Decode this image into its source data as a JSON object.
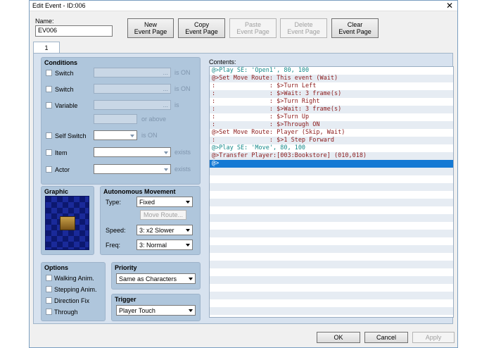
{
  "window": {
    "title": "Edit Event - ID:006",
    "close": "✕"
  },
  "name": {
    "label": "Name:",
    "value": "EV006"
  },
  "toolbar": {
    "new": "New\nEvent Page",
    "copy": "Copy\nEvent Page",
    "paste": "Paste\nEvent Page",
    "delete": "Delete\nEvent Page",
    "clear": "Clear\nEvent Page"
  },
  "tab": "1",
  "conditions": {
    "title": "Conditions",
    "switch1": "Switch",
    "switch2": "Switch",
    "variable": "Variable",
    "self_switch": "Self Switch",
    "item": "Item",
    "actor": "Actor",
    "is_on": "is ON",
    "is": "is",
    "or_above": "or above",
    "exists": "exists",
    "ellipsis": "..."
  },
  "graphic": {
    "title": "Graphic"
  },
  "movement": {
    "title": "Autonomous Movement",
    "type_label": "Type:",
    "type": "Fixed",
    "route": "Move Route...",
    "speed_label": "Speed:",
    "speed": "3: x2 Slower",
    "freq_label": "Freq:",
    "freq": "3: Normal"
  },
  "options": {
    "title": "Options",
    "walking": "Walking Anim.",
    "stepping": "Stepping Anim.",
    "direction": "Direction Fix",
    "through": "Through"
  },
  "priority": {
    "title": "Priority",
    "value": "Same as Characters"
  },
  "trigger": {
    "title": "Trigger",
    "value": "Player Touch"
  },
  "contents": {
    "title": "Contents:",
    "lines": [
      {
        "text": "@>Play SE: 'Open1', 80, 100",
        "color": "#138a8a"
      },
      {
        "text": "@>Set Move Route: This event (Wait)",
        "color": "#8b1a1a"
      },
      {
        "text": ":               : $>Turn Left",
        "color": "#8b1a1a"
      },
      {
        "text": ":               : $>Wait: 3 frame(s)",
        "color": "#8b1a1a"
      },
      {
        "text": ":               : $>Turn Right",
        "color": "#8b1a1a"
      },
      {
        "text": ":               : $>Wait: 3 frame(s)",
        "color": "#8b1a1a"
      },
      {
        "text": ":               : $>Turn Up",
        "color": "#8b1a1a"
      },
      {
        "text": ":               : $>Through ON",
        "color": "#8b1a1a"
      },
      {
        "text": "@>Set Move Route: Player (Skip, Wait)",
        "color": "#8b1a1a"
      },
      {
        "text": ":               : $>1 Step Forward",
        "color": "#8b1a1a"
      },
      {
        "text": "@>Play SE: 'Move', 80, 100",
        "color": "#138a8a"
      },
      {
        "text": "@>Transfer Player:[003:Bookstore] (010,018)",
        "color": "#8b1a1a"
      },
      {
        "text": "@>",
        "color": "#ffffff"
      }
    ]
  },
  "footer": {
    "ok": "OK",
    "cancel": "Cancel",
    "apply": "Apply"
  }
}
